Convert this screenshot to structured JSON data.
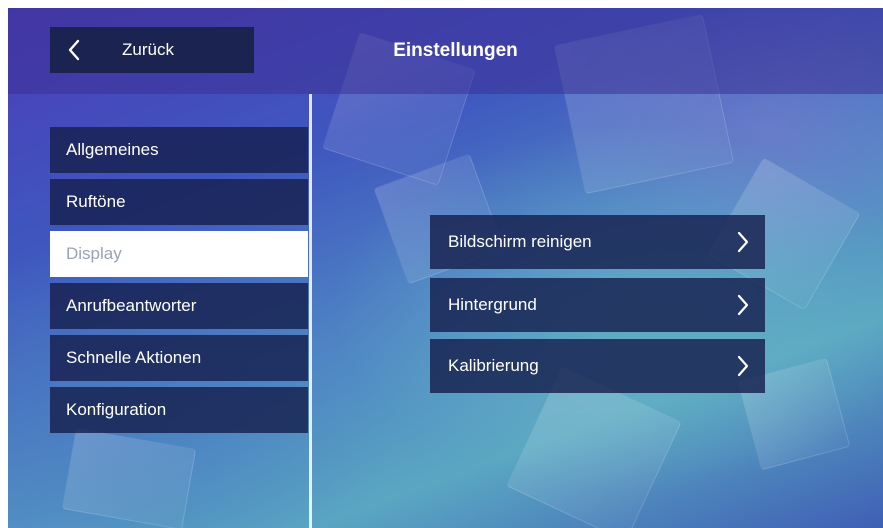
{
  "header": {
    "back_label": "Zurück",
    "title": "Einstellungen"
  },
  "sidebar": {
    "items": [
      {
        "label": "Allgemeines",
        "active": false
      },
      {
        "label": "Ruftöne",
        "active": false
      },
      {
        "label": "Display",
        "active": true
      },
      {
        "label": "Anrufbeantworter",
        "active": false
      },
      {
        "label": "Schnelle Aktionen",
        "active": false
      },
      {
        "label": "Konfiguration",
        "active": false
      }
    ]
  },
  "main": {
    "options": [
      {
        "label": "Bildschirm reinigen",
        "icon": "chevron-right-icon"
      },
      {
        "label": "Hintergrund",
        "icon": "chevron-right-icon"
      },
      {
        "label": "Kalibrierung",
        "icon": "chevron-right-icon"
      }
    ]
  },
  "icons": {
    "back": "chevron-left-icon"
  },
  "colors": {
    "panel": "#16204e",
    "active_bg": "#ffffff",
    "active_text": "#9aa3b5",
    "text": "#ffffff"
  }
}
